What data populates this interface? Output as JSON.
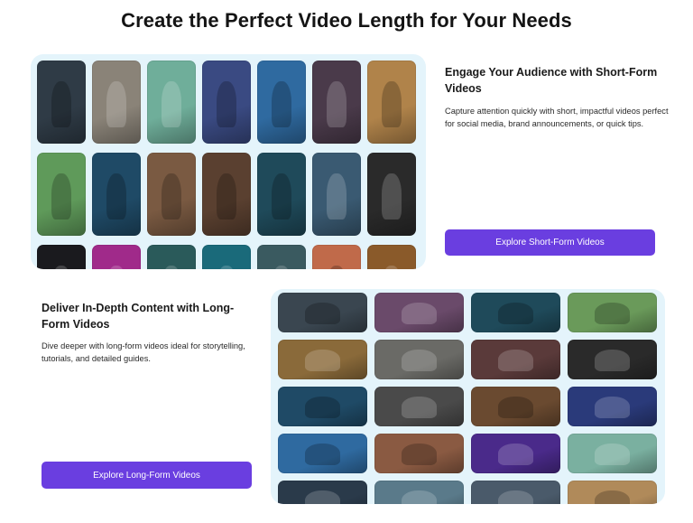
{
  "page": {
    "title": "Create the Perfect Video Length for Your Needs"
  },
  "short_form": {
    "heading": "Engage Your Audience with Short-Form Videos",
    "description": "Capture attention quickly with short, impactful videos perfect for social media, brand announcements, or quick tips.",
    "button_label": "Explore Short-Form Videos",
    "thumbnails": [
      {
        "name": "soldiers-smoke",
        "color": "#2f3b46",
        "light": false
      },
      {
        "name": "photographer-city",
        "color": "#8a8378",
        "light": true
      },
      {
        "name": "retro-cars-street",
        "color": "#6fae9a",
        "light": true
      },
      {
        "name": "vr-headset",
        "color": "#3a4a82",
        "light": false
      },
      {
        "name": "little-fairy",
        "color": "#2f6aa0",
        "light": false
      },
      {
        "name": "red-moon-figure",
        "color": "#4a3a4a",
        "light": true
      },
      {
        "name": "horse-rider",
        "color": "#b0834a",
        "light": false
      },
      {
        "name": "village-houses",
        "color": "#5f9a5a",
        "light": false
      },
      {
        "name": "scientist-lab",
        "color": "#1f4a66",
        "light": false
      },
      {
        "name": "warrior-statue",
        "color": "#7a5a42",
        "light": false
      },
      {
        "name": "eye-closeup",
        "color": "#5a4030",
        "light": false
      },
      {
        "name": "wizard-boy",
        "color": "#1f4a5a",
        "light": false
      },
      {
        "name": "lighthouse-waves",
        "color": "#3a5a72",
        "light": true
      },
      {
        "name": "woman-profile",
        "color": "#2a2a2a",
        "light": true
      },
      {
        "name": "dark-silhouette",
        "color": "#1a1a1e",
        "light": true
      },
      {
        "name": "pink-neon",
        "color": "#a02a8a",
        "light": true
      },
      {
        "name": "moonlit-figure",
        "color": "#2a5a5a",
        "light": true
      },
      {
        "name": "teal-neon",
        "color": "#1a6a7a",
        "light": true
      },
      {
        "name": "forest-path",
        "color": "#3a5a60",
        "light": true
      },
      {
        "name": "sunset-silhouette",
        "color": "#c06a4a",
        "light": false
      },
      {
        "name": "golden-hall",
        "color": "#8a5a2a",
        "light": true
      }
    ]
  },
  "long_form": {
    "heading": "Deliver In-Depth Content with Long-Form Videos",
    "description": "Dive deeper with long-form videos ideal for storytelling, tutorials, and detailed guides.",
    "button_label": "Explore Long-Form Videos",
    "thumbnails": [
      {
        "name": "soldiers-smoke",
        "color": "#3a4650",
        "light": false
      },
      {
        "name": "rock-formations",
        "color": "#6a4a6a",
        "light": true
      },
      {
        "name": "wizard-boy",
        "color": "#1f4a5a",
        "light": false
      },
      {
        "name": "village-houses",
        "color": "#6a9a5a",
        "light": false
      },
      {
        "name": "dancers-hall",
        "color": "#8a6a3a",
        "light": true
      },
      {
        "name": "photographer-city",
        "color": "#6a6a66",
        "light": true
      },
      {
        "name": "red-moon-figure",
        "color": "#5a3a3a",
        "light": true
      },
      {
        "name": "woman-profile",
        "color": "#2a2a2a",
        "light": true
      },
      {
        "name": "scientist-lab",
        "color": "#1f4a66",
        "light": false
      },
      {
        "name": "shadow-figure",
        "color": "#4a4a4a",
        "light": true
      },
      {
        "name": "eye-closeup",
        "color": "#6a4a30",
        "light": false
      },
      {
        "name": "vr-neon",
        "color": "#2a3a7a",
        "light": true
      },
      {
        "name": "little-fairy",
        "color": "#2f6aa0",
        "light": false
      },
      {
        "name": "warrior-statue",
        "color": "#8a5a42",
        "light": false
      },
      {
        "name": "neon-road",
        "color": "#4a2a8a",
        "light": true
      },
      {
        "name": "retro-cars-street",
        "color": "#7ab0a0",
        "light": true
      },
      {
        "name": "creature-dark",
        "color": "#2a3a4a",
        "light": true
      },
      {
        "name": "lighthouse-coast",
        "color": "#5a7a8a",
        "light": true
      },
      {
        "name": "stormy-sky",
        "color": "#4a5a6a",
        "light": true
      },
      {
        "name": "horse-rider",
        "color": "#b08a5a",
        "light": false
      }
    ]
  }
}
